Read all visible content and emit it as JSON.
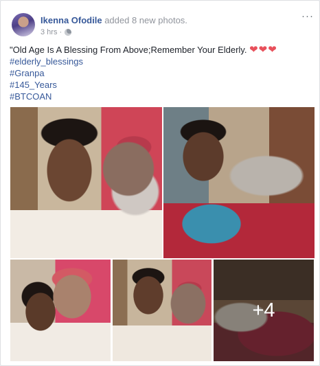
{
  "post": {
    "author": "Ikenna Ofodile",
    "action": "added 8 new photos.",
    "time": "3 hrs",
    "separator": "·",
    "more_label": "···",
    "text_line": "\"Old Age Is A Blessing From Above;Remember Your Elderly.",
    "hearts": "❤❤❤",
    "hashtags": [
      "#elderly_blessings",
      "#Granpa",
      "#145_Years",
      "#BTCOAN"
    ],
    "extra_photos_label": "+4"
  },
  "colors": {
    "link": "#365899",
    "meta": "#90949c",
    "heart": "#e8505b",
    "background": "#e9ebee"
  },
  "icons": [
    "globe-icon",
    "more-options-icon",
    "heart-icon"
  ]
}
